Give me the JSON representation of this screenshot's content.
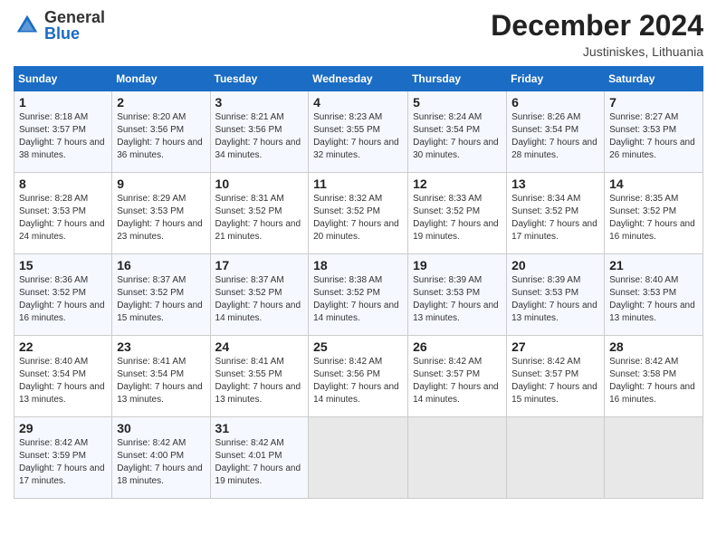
{
  "header": {
    "logo_general": "General",
    "logo_blue": "Blue",
    "month_title": "December 2024",
    "location": "Justiniskes, Lithuania"
  },
  "weekdays": [
    "Sunday",
    "Monday",
    "Tuesday",
    "Wednesday",
    "Thursday",
    "Friday",
    "Saturday"
  ],
  "weeks": [
    [
      {
        "day": "1",
        "sunrise": "Sunrise: 8:18 AM",
        "sunset": "Sunset: 3:57 PM",
        "daylight": "Daylight: 7 hours and 38 minutes."
      },
      {
        "day": "2",
        "sunrise": "Sunrise: 8:20 AM",
        "sunset": "Sunset: 3:56 PM",
        "daylight": "Daylight: 7 hours and 36 minutes."
      },
      {
        "day": "3",
        "sunrise": "Sunrise: 8:21 AM",
        "sunset": "Sunset: 3:56 PM",
        "daylight": "Daylight: 7 hours and 34 minutes."
      },
      {
        "day": "4",
        "sunrise": "Sunrise: 8:23 AM",
        "sunset": "Sunset: 3:55 PM",
        "daylight": "Daylight: 7 hours and 32 minutes."
      },
      {
        "day": "5",
        "sunrise": "Sunrise: 8:24 AM",
        "sunset": "Sunset: 3:54 PM",
        "daylight": "Daylight: 7 hours and 30 minutes."
      },
      {
        "day": "6",
        "sunrise": "Sunrise: 8:26 AM",
        "sunset": "Sunset: 3:54 PM",
        "daylight": "Daylight: 7 hours and 28 minutes."
      },
      {
        "day": "7",
        "sunrise": "Sunrise: 8:27 AM",
        "sunset": "Sunset: 3:53 PM",
        "daylight": "Daylight: 7 hours and 26 minutes."
      }
    ],
    [
      {
        "day": "8",
        "sunrise": "Sunrise: 8:28 AM",
        "sunset": "Sunset: 3:53 PM",
        "daylight": "Daylight: 7 hours and 24 minutes."
      },
      {
        "day": "9",
        "sunrise": "Sunrise: 8:29 AM",
        "sunset": "Sunset: 3:53 PM",
        "daylight": "Daylight: 7 hours and 23 minutes."
      },
      {
        "day": "10",
        "sunrise": "Sunrise: 8:31 AM",
        "sunset": "Sunset: 3:52 PM",
        "daylight": "Daylight: 7 hours and 21 minutes."
      },
      {
        "day": "11",
        "sunrise": "Sunrise: 8:32 AM",
        "sunset": "Sunset: 3:52 PM",
        "daylight": "Daylight: 7 hours and 20 minutes."
      },
      {
        "day": "12",
        "sunrise": "Sunrise: 8:33 AM",
        "sunset": "Sunset: 3:52 PM",
        "daylight": "Daylight: 7 hours and 19 minutes."
      },
      {
        "day": "13",
        "sunrise": "Sunrise: 8:34 AM",
        "sunset": "Sunset: 3:52 PM",
        "daylight": "Daylight: 7 hours and 17 minutes."
      },
      {
        "day": "14",
        "sunrise": "Sunrise: 8:35 AM",
        "sunset": "Sunset: 3:52 PM",
        "daylight": "Daylight: 7 hours and 16 minutes."
      }
    ],
    [
      {
        "day": "15",
        "sunrise": "Sunrise: 8:36 AM",
        "sunset": "Sunset: 3:52 PM",
        "daylight": "Daylight: 7 hours and 16 minutes."
      },
      {
        "day": "16",
        "sunrise": "Sunrise: 8:37 AM",
        "sunset": "Sunset: 3:52 PM",
        "daylight": "Daylight: 7 hours and 15 minutes."
      },
      {
        "day": "17",
        "sunrise": "Sunrise: 8:37 AM",
        "sunset": "Sunset: 3:52 PM",
        "daylight": "Daylight: 7 hours and 14 minutes."
      },
      {
        "day": "18",
        "sunrise": "Sunrise: 8:38 AM",
        "sunset": "Sunset: 3:52 PM",
        "daylight": "Daylight: 7 hours and 14 minutes."
      },
      {
        "day": "19",
        "sunrise": "Sunrise: 8:39 AM",
        "sunset": "Sunset: 3:53 PM",
        "daylight": "Daylight: 7 hours and 13 minutes."
      },
      {
        "day": "20",
        "sunrise": "Sunrise: 8:39 AM",
        "sunset": "Sunset: 3:53 PM",
        "daylight": "Daylight: 7 hours and 13 minutes."
      },
      {
        "day": "21",
        "sunrise": "Sunrise: 8:40 AM",
        "sunset": "Sunset: 3:53 PM",
        "daylight": "Daylight: 7 hours and 13 minutes."
      }
    ],
    [
      {
        "day": "22",
        "sunrise": "Sunrise: 8:40 AM",
        "sunset": "Sunset: 3:54 PM",
        "daylight": "Daylight: 7 hours and 13 minutes."
      },
      {
        "day": "23",
        "sunrise": "Sunrise: 8:41 AM",
        "sunset": "Sunset: 3:54 PM",
        "daylight": "Daylight: 7 hours and 13 minutes."
      },
      {
        "day": "24",
        "sunrise": "Sunrise: 8:41 AM",
        "sunset": "Sunset: 3:55 PM",
        "daylight": "Daylight: 7 hours and 13 minutes."
      },
      {
        "day": "25",
        "sunrise": "Sunrise: 8:42 AM",
        "sunset": "Sunset: 3:56 PM",
        "daylight": "Daylight: 7 hours and 14 minutes."
      },
      {
        "day": "26",
        "sunrise": "Sunrise: 8:42 AM",
        "sunset": "Sunset: 3:57 PM",
        "daylight": "Daylight: 7 hours and 14 minutes."
      },
      {
        "day": "27",
        "sunrise": "Sunrise: 8:42 AM",
        "sunset": "Sunset: 3:57 PM",
        "daylight": "Daylight: 7 hours and 15 minutes."
      },
      {
        "day": "28",
        "sunrise": "Sunrise: 8:42 AM",
        "sunset": "Sunset: 3:58 PM",
        "daylight": "Daylight: 7 hours and 16 minutes."
      }
    ],
    [
      {
        "day": "29",
        "sunrise": "Sunrise: 8:42 AM",
        "sunset": "Sunset: 3:59 PM",
        "daylight": "Daylight: 7 hours and 17 minutes."
      },
      {
        "day": "30",
        "sunrise": "Sunrise: 8:42 AM",
        "sunset": "Sunset: 4:00 PM",
        "daylight": "Daylight: 7 hours and 18 minutes."
      },
      {
        "day": "31",
        "sunrise": "Sunrise: 8:42 AM",
        "sunset": "Sunset: 4:01 PM",
        "daylight": "Daylight: 7 hours and 19 minutes."
      },
      null,
      null,
      null,
      null
    ]
  ]
}
